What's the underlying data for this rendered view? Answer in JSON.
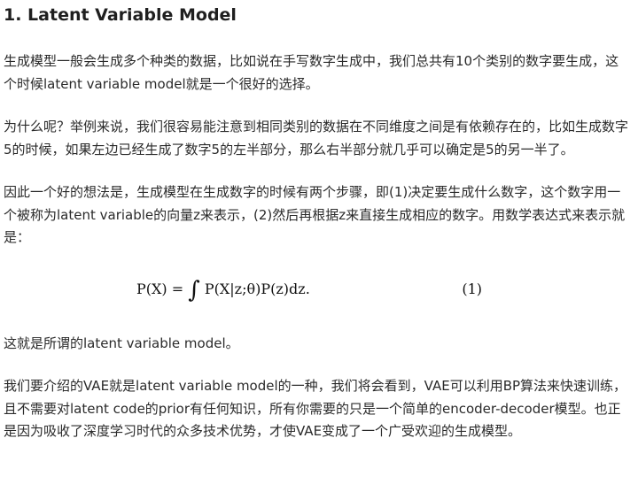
{
  "article": {
    "heading": "1. Latent Variable Model",
    "paragraphs": [
      "生成模型一般会生成多个种类的数据，比如说在手写数字生成中，我们总共有10个类别的数字要生成，这个时候latent variable model就是一个很好的选择。",
      "为什么呢？举例来说，我们很容易能注意到相同类别的数据在不同维度之间是有依赖存在的，比如生成数字5的时候，如果左边已经生成了数字5的左半部分，那么右半部分就几乎可以确定是5的另一半了。",
      "因此一个好的想法是，生成模型在生成数字的时候有两个步骤，即(1)决定要生成什么数字，这个数字用一个被称为latent variable的向量z来表示，(2)然后再根据z来直接生成相应的数字。用数学表达式来表示就是："
    ],
    "equation": {
      "lhs": "P(X) = ",
      "integral": "∫",
      "rhs": " P(X|z;θ)P(z)dz.",
      "number": "(1)"
    },
    "after_paragraphs": [
      "这就是所谓的latent variable model。",
      "我们要介绍的VAE就是latent variable model的一种，我们将会看到，VAE可以利用BP算法来快速训练，且不需要对latent code的prior有任何知识，所有你需要的只是一个简单的encoder-decoder模型。也正是因为吸收了深度学习时代的众多技术优势，才使VAE变成了一个广受欢迎的生成模型。"
    ]
  }
}
